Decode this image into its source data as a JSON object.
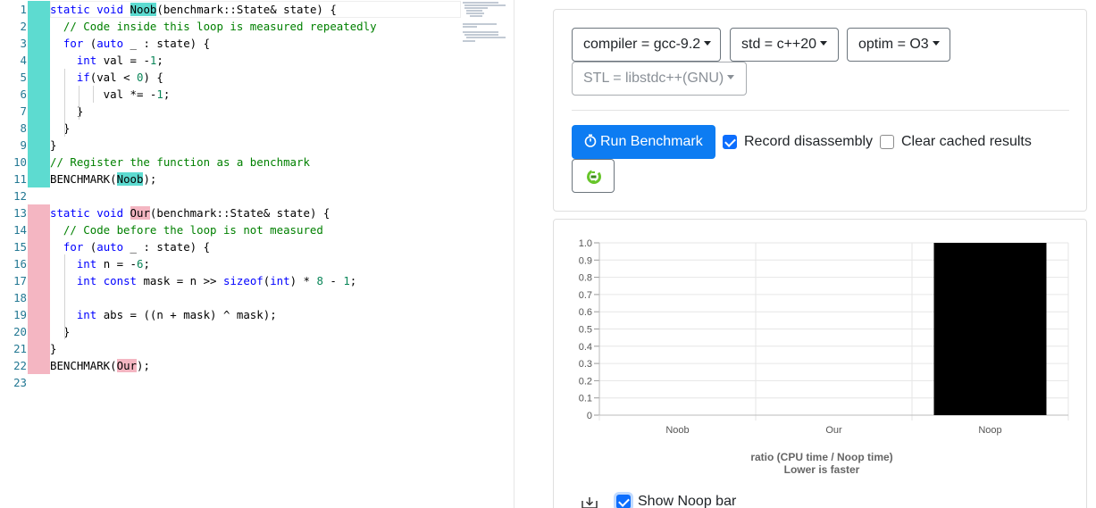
{
  "editor": {
    "lines": [
      {
        "n": "1",
        "marker": "teal",
        "segs": [
          [
            "kw",
            "static "
          ],
          [
            "kw",
            "void "
          ],
          [
            "hl-teal",
            "Noob"
          ],
          [
            "",
            "(benchmark::State& state) {"
          ]
        ]
      },
      {
        "n": "2",
        "marker": "teal",
        "segs": [
          [
            "",
            "  "
          ],
          [
            "cm",
            "// Code inside this loop is measured repeatedly"
          ]
        ]
      },
      {
        "n": "3",
        "marker": "teal",
        "segs": [
          [
            "",
            "  "
          ],
          [
            "kw",
            "for"
          ],
          [
            "",
            " ("
          ],
          [
            "kw",
            "auto"
          ],
          [
            "",
            " _ : state) {"
          ]
        ]
      },
      {
        "n": "4",
        "marker": "teal",
        "segs": [
          [
            "",
            "    "
          ],
          [
            "kw",
            "int"
          ],
          [
            "",
            " val = -"
          ],
          [
            "num",
            "1"
          ],
          [
            "",
            ";"
          ]
        ]
      },
      {
        "n": "5",
        "marker": "teal",
        "segs": [
          [
            "",
            "    "
          ],
          [
            "kw",
            "if"
          ],
          [
            "",
            "(val < "
          ],
          [
            "num",
            "0"
          ],
          [
            "",
            ") {"
          ]
        ]
      },
      {
        "n": "6",
        "marker": "teal",
        "segs": [
          [
            "",
            "        val *= -"
          ],
          [
            "num",
            "1"
          ],
          [
            "",
            ";"
          ]
        ]
      },
      {
        "n": "7",
        "marker": "teal",
        "segs": [
          [
            "",
            "    }"
          ]
        ]
      },
      {
        "n": "8",
        "marker": "teal",
        "segs": [
          [
            "",
            "  }"
          ]
        ]
      },
      {
        "n": "9",
        "marker": "teal",
        "segs": [
          [
            "",
            "}"
          ]
        ]
      },
      {
        "n": "10",
        "marker": "teal",
        "segs": [
          [
            "cm",
            "// Register the function as a benchmark"
          ]
        ]
      },
      {
        "n": "11",
        "marker": "teal",
        "segs": [
          [
            "",
            "BENCHMARK("
          ],
          [
            "hl-teal",
            "Noob"
          ],
          [
            "",
            ");"
          ]
        ]
      },
      {
        "n": "12",
        "marker": "",
        "segs": []
      },
      {
        "n": "13",
        "marker": "pink",
        "segs": [
          [
            "kw",
            "static "
          ],
          [
            "kw",
            "void "
          ],
          [
            "hl-pink",
            "Our"
          ],
          [
            "",
            "(benchmark::State& state) {"
          ]
        ]
      },
      {
        "n": "14",
        "marker": "pink",
        "segs": [
          [
            "",
            "  "
          ],
          [
            "cm",
            "// Code before the loop is not measured"
          ]
        ]
      },
      {
        "n": "15",
        "marker": "pink",
        "segs": [
          [
            "",
            "  "
          ],
          [
            "kw",
            "for"
          ],
          [
            "",
            " ("
          ],
          [
            "kw",
            "auto"
          ],
          [
            "",
            " _ : state) {"
          ]
        ]
      },
      {
        "n": "16",
        "marker": "pink",
        "segs": [
          [
            "",
            "    "
          ],
          [
            "kw",
            "int"
          ],
          [
            "",
            " n = -"
          ],
          [
            "num",
            "6"
          ],
          [
            "",
            ";"
          ]
        ]
      },
      {
        "n": "17",
        "marker": "pink",
        "segs": [
          [
            "",
            "    "
          ],
          [
            "kw",
            "int "
          ],
          [
            "kw",
            "const"
          ],
          [
            "",
            " mask = n >> "
          ],
          [
            "kw",
            "sizeof"
          ],
          [
            "",
            "("
          ],
          [
            "kw",
            "int"
          ],
          [
            "",
            ") * "
          ],
          [
            "num",
            "8"
          ],
          [
            "",
            " - "
          ],
          [
            "num",
            "1"
          ],
          [
            "",
            ";"
          ]
        ]
      },
      {
        "n": "18",
        "marker": "pink",
        "segs": []
      },
      {
        "n": "19",
        "marker": "pink",
        "segs": [
          [
            "",
            "    "
          ],
          [
            "kw",
            "int"
          ],
          [
            "",
            " abs = ((n + mask) ^ mask);"
          ]
        ]
      },
      {
        "n": "20",
        "marker": "pink",
        "segs": [
          [
            "",
            "  }"
          ]
        ]
      },
      {
        "n": "21",
        "marker": "pink",
        "segs": [
          [
            "",
            "}"
          ]
        ]
      },
      {
        "n": "22",
        "marker": "pink",
        "segs": [
          [
            "",
            "BENCHMARK("
          ],
          [
            "hl-pink",
            "Our"
          ],
          [
            "",
            ");"
          ]
        ]
      },
      {
        "n": "23",
        "marker": "",
        "segs": []
      }
    ]
  },
  "options": {
    "compiler": "compiler = gcc-9.2",
    "std": "std = c++20",
    "optim": "optim = O3",
    "stl": "STL = libstdc++(GNU)"
  },
  "actions": {
    "run_label": "Run Benchmark",
    "run_icon": "stopwatch-icon",
    "record_disassembly": "Record disassembly",
    "record_checked": true,
    "clear_cache": "Clear cached results",
    "clear_checked": false,
    "ce_icon": "compiler-explorer-icon"
  },
  "chart_data": {
    "type": "bar",
    "categories": [
      "Noob",
      "Our",
      "Noop"
    ],
    "values": [
      0,
      0,
      1.0
    ],
    "ylim": [
      0,
      1.0
    ],
    "yticks": [
      "0",
      "0.1",
      "0.2",
      "0.3",
      "0.4",
      "0.5",
      "0.6",
      "0.7",
      "0.8",
      "0.9",
      "1.0"
    ],
    "xlabel": "ratio (CPU time / Noop time)",
    "xlabel2": "Lower is faster",
    "bar_color": "#000000",
    "grid": true
  },
  "footer": {
    "download_icon": "download-icon",
    "show_noop_label": "Show Noop bar",
    "show_noop_checked": true
  },
  "colors": {
    "accent": "#0d7cf2",
    "noob_marker": "#5ddbd0",
    "our_marker": "#f4b6c2"
  }
}
